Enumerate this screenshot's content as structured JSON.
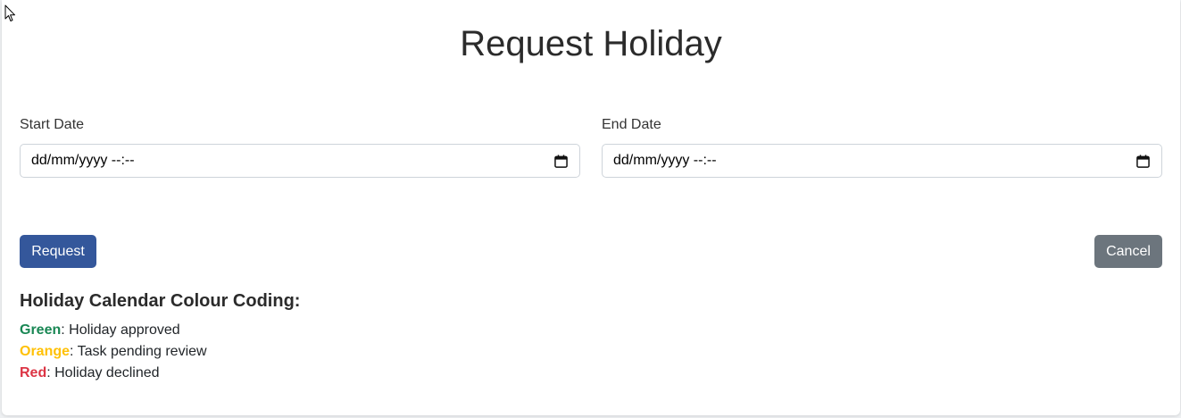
{
  "page": {
    "title": "Request Holiday"
  },
  "form": {
    "start_date": {
      "label": "Start Date",
      "placeholder": "dd/mm/yyyy --:--"
    },
    "end_date": {
      "label": "End Date",
      "placeholder": "dd/mm/yyyy --:--"
    },
    "request_label": "Request",
    "cancel_label": "Cancel"
  },
  "legend": {
    "title": "Holiday Calendar Colour Coding:",
    "items": [
      {
        "key": "Green",
        "text": ": Holiday approved",
        "color": "#198754"
      },
      {
        "key": "Orange",
        "text": ": Task pending review",
        "color": "#ffc107"
      },
      {
        "key": "Red",
        "text": ": Holiday declined",
        "color": "#dc3545"
      }
    ]
  },
  "colors": {
    "primary_button": "#34579b",
    "secondary_button": "#6c757d"
  },
  "icons": {
    "cursor": "mouse-pointer-icon",
    "date_picker": "calendar-icon"
  }
}
